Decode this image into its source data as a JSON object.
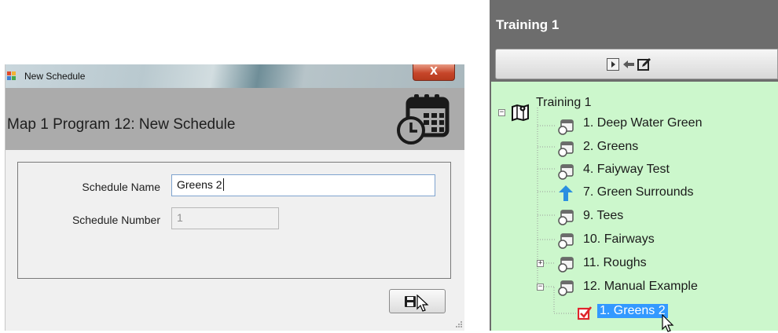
{
  "dialog": {
    "title": "New Schedule",
    "close_label": "X",
    "header_title": "Map 1 Program 12: New Schedule",
    "header_icon": "calendar-clock-icon",
    "fields": {
      "schedule_name_label": "Schedule Name",
      "schedule_name_value": "Greens 2",
      "schedule_number_label": "Schedule Number",
      "schedule_number_value": "1"
    },
    "save_icon": "save-icon"
  },
  "panel": {
    "title": "Training 1",
    "toolbar_icons": [
      "play-icon",
      "arrow-left-icon",
      "edit-icon"
    ],
    "tree": {
      "root_label": "Training 1",
      "items": [
        {
          "label": "1. Deep Water Green",
          "icon": "schedule-icon"
        },
        {
          "label": "2. Greens",
          "icon": "schedule-icon"
        },
        {
          "label": "4. Faiyway Test",
          "icon": "schedule-icon"
        },
        {
          "label": "7. Green Surrounds",
          "icon": "arrow-up-icon"
        },
        {
          "label": "9. Tees",
          "icon": "schedule-icon"
        },
        {
          "label": "10. Fairways",
          "icon": "schedule-icon"
        },
        {
          "label": "11. Roughs",
          "icon": "schedule-icon"
        },
        {
          "label": "12. Manual Example",
          "icon": "schedule-icon"
        }
      ],
      "child_label": "1. Greens 2"
    }
  },
  "colors": {
    "header_bg": "#ababab",
    "panel_bg": "#6d6d6d",
    "tree_bg": "#ccf7cc",
    "selection": "#3399ff",
    "close_red": "#c6462a"
  }
}
